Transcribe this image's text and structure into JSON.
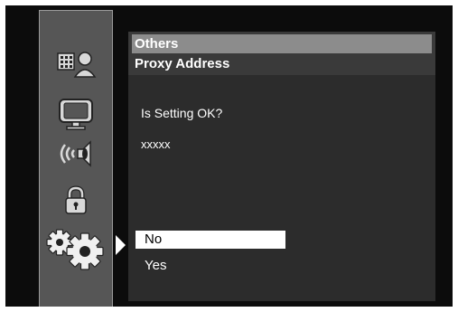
{
  "sidebar": {
    "items": [
      {
        "icon": "media-info-icon"
      },
      {
        "icon": "display-monitor-icon"
      },
      {
        "icon": "speaker-sound-icon"
      },
      {
        "icon": "lock-icon"
      },
      {
        "icon": "settings-gears-icon"
      }
    ],
    "active_index": 4
  },
  "header": {
    "title": "Others",
    "subtitle": "Proxy Address"
  },
  "dialog": {
    "prompt": "Is Setting OK?",
    "value": "xxxxx",
    "options": [
      {
        "label": "No",
        "selected": true
      },
      {
        "label": "Yes",
        "selected": false
      }
    ]
  },
  "colors": {
    "background": "#0c0c0c",
    "sidebar": "#565656",
    "panel": "#2c2c2c",
    "header_highlight": "#8c8c8c",
    "selected_option": "#ffffff"
  }
}
